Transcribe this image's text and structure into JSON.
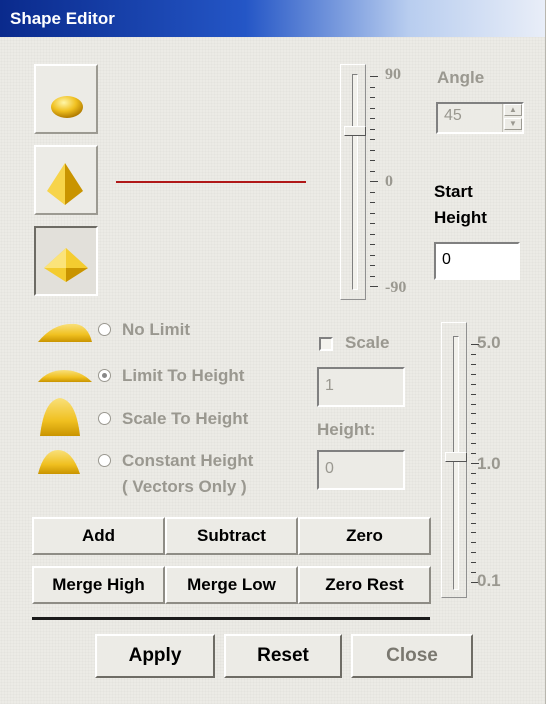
{
  "window": {
    "title": "Shape Editor"
  },
  "shapes": {
    "dome": "dome-shape-icon",
    "pyramid": "pyramid-shape-icon",
    "diamond": "diamond-shape-icon",
    "selected": "diamond"
  },
  "angle_slider": {
    "top_label": "90",
    "mid_label": "0",
    "bottom_label": "-90",
    "value": 45,
    "range": [
      -90,
      90
    ]
  },
  "angle": {
    "label": "Angle",
    "value": "45"
  },
  "start_height": {
    "label_line1": "Start",
    "label_line2": "Height",
    "value": "0"
  },
  "limit_options": [
    {
      "label": "No Limit",
      "selected": false
    },
    {
      "label": "Limit To Height",
      "selected": true
    },
    {
      "label": "Scale To Height",
      "selected": false
    },
    {
      "label": "Constant Height",
      "label2": "( Vectors Only )",
      "selected": false
    }
  ],
  "scale": {
    "label": "Scale",
    "checked": false,
    "value": "1"
  },
  "height": {
    "label": "Height:",
    "value": "0"
  },
  "scale_slider": {
    "top_label": "5.0",
    "mid_label": "1.0",
    "bottom_label": "0.1",
    "value": 1.0
  },
  "ops": {
    "add": "Add",
    "subtract": "Subtract",
    "zero": "Zero",
    "merge_high": "Merge High",
    "merge_low": "Merge Low",
    "zero_rest": "Zero Rest"
  },
  "buttons": {
    "apply": "Apply",
    "reset": "Reset",
    "close": "Close"
  },
  "colors": {
    "shape_gold": "#f0c020",
    "profile_line": "#b01818",
    "title_bar": "#0a2a8c"
  }
}
